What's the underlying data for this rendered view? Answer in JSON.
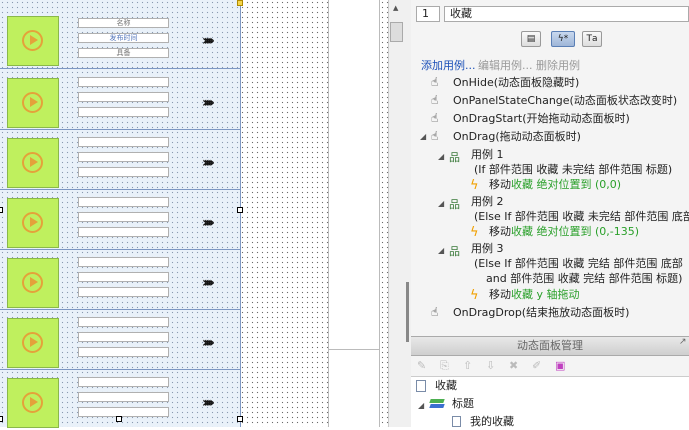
{
  "canvas": {
    "first_item_labels": [
      "名称",
      "发布时间",
      "具备"
    ]
  },
  "properties": {
    "index_value": "1",
    "name_value": "收藏",
    "view_tabs": [
      "notes-icon",
      "interaction-icon",
      "text-style-icon"
    ]
  },
  "case_actions": {
    "add": "添加用例...",
    "edit": "编辑用例...",
    "delete": "删除用例"
  },
  "events": [
    {
      "label": "OnHide(动态面板隐藏时)"
    },
    {
      "label": "OnPanelStateChange(动态面板状态改变时)"
    },
    {
      "label": "OnDragStart(开始拖动动态面板时)"
    },
    {
      "label": "OnDrag(拖动动态面板时)"
    },
    {
      "label": "OnDragDrop(结束拖放动态面板时)"
    }
  ],
  "cases": [
    {
      "name": "用例 1",
      "condition_lines": [
        "(If 部件范围 收藏 未完结 部件范围 标题)"
      ],
      "action_prefix": "移动",
      "action_green": "收藏 绝对位置到 (0,0)"
    },
    {
      "name": "用例 2",
      "condition_lines": [
        "(Else If 部件范围 收藏 未完结 部件范围 底部)"
      ],
      "action_prefix": "移动",
      "action_green": "收藏 绝对位置到 (0,-135)"
    },
    {
      "name": "用例 3",
      "condition_lines": [
        "(Else If 部件范围 收藏 完结 部件范围 底部",
        "and 部件范围 收藏 完结 部件范围 标题)"
      ],
      "action_prefix": "移动",
      "action_green": "收藏 y 轴拖动"
    }
  ],
  "dynamic_panel_manager": {
    "title": "动态面板管理",
    "tree": [
      {
        "label": "收藏",
        "icon": "page-icon"
      },
      {
        "label": "标题",
        "icon": "layers-icon"
      },
      {
        "label": "我的收藏",
        "icon": "state-icon"
      }
    ]
  },
  "colors": {
    "accent_blue": "#1a4fb8",
    "action_green": "#2aa02a",
    "thumbnail_green": "#bff05e"
  }
}
